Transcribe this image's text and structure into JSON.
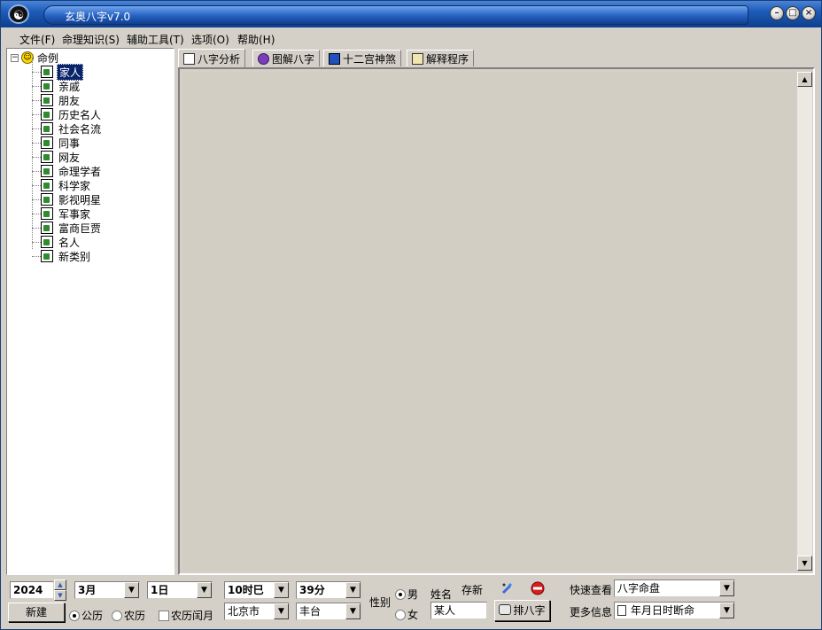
{
  "window": {
    "title": "玄奥八字v7.0"
  },
  "menu": {
    "items": [
      "文件(F)",
      "命理知识(S)",
      "辅助工具(T)",
      "选项(O)",
      "帮助(H)"
    ]
  },
  "tree": {
    "root": "命例",
    "toggle": "⊟",
    "items": [
      "家人",
      "亲戚",
      "朋友",
      "历史名人",
      "社会名流",
      "同事",
      "网友",
      "命理学者",
      "科学家",
      "影视明星",
      "军事家",
      "富商巨贾",
      "名人",
      "新类别"
    ]
  },
  "tabs": [
    "八字分析",
    "图解八字",
    "十二宫神煞",
    "解释程序"
  ],
  "form": {
    "year": "2024",
    "month": "3月",
    "day": "1日",
    "hour": "10时巳",
    "minute": "39分",
    "new_button": "新建",
    "calendar_solar": "公历",
    "calendar_lunar": "农历",
    "lunar_leap": "农历闰月",
    "city": "北京市",
    "district": "丰台",
    "gender_label": "性别",
    "gender_male": "男",
    "gender_female": "女",
    "name_label": "姓名",
    "name_value": "某人",
    "save_new": "存新",
    "pai_button": "排八字",
    "quick_view_label": "快速查看",
    "quick_view_value": "八字命盘",
    "more_info_label": "更多信息",
    "more_info_value": "年月日时断命"
  }
}
